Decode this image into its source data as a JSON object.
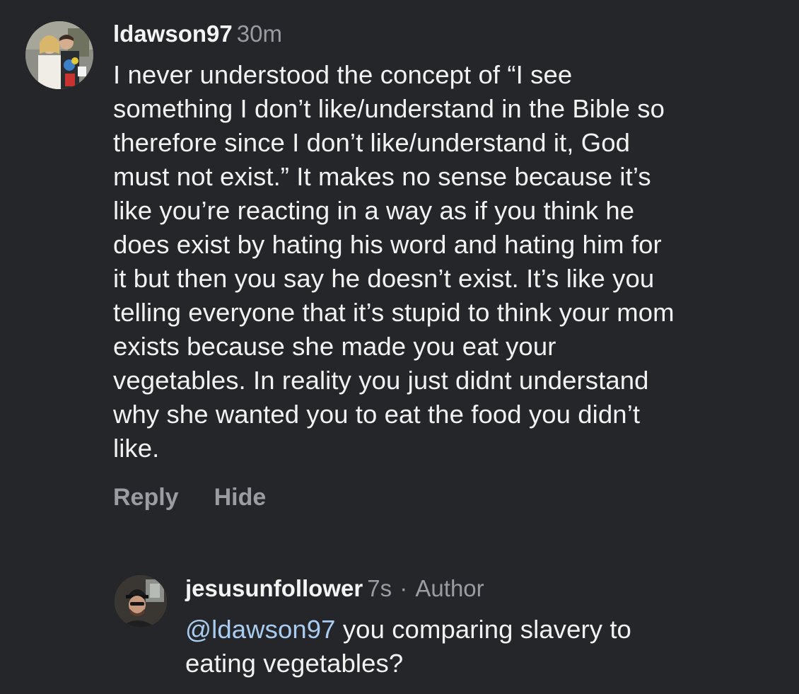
{
  "comments": [
    {
      "username": "ldawson97",
      "time": "30m",
      "text": "I never understood the concept of “I see\nsomething I don’t like/understand in the Bible so\ntherefore since I don’t like/understand it, God\nmust not exist.” It makes no sense because it’s\nlike you’re reacting in a way as if you think he\ndoes exist by hating his word and hating him for\nit but then you say he doesn’t exist. It’s like you\ntelling everyone that it’s stupid to think your mom\nexists because she made you eat your\nvegetables. In reality you just didnt understand\nwhy she wanted you to eat the food you didn’t\nlike.",
      "actions": {
        "reply_label": "Reply",
        "hide_label": "Hide"
      }
    },
    {
      "username": "jesusunfollower",
      "time": "7s",
      "separator": "·",
      "role": "Author",
      "mention": "@ldawson97",
      "text": " you comparing slavery to\neating vegetables?"
    }
  ],
  "colors": {
    "background": "#24262a",
    "primary_text": "#f2f2f2",
    "secondary_text": "#9a9ca1",
    "mention": "#a8cdf0"
  },
  "icons": {
    "comment_avatar": "user-avatar-photo",
    "reply_avatar": "user-avatar-photo"
  }
}
